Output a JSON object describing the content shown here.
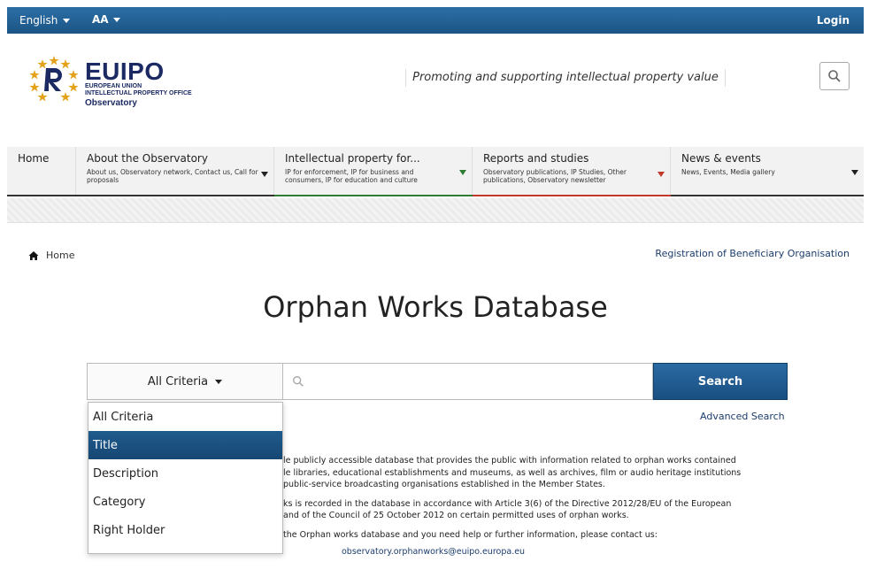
{
  "topbar": {
    "language": "English",
    "font_size": "AA",
    "login": "Login"
  },
  "header": {
    "brand": "EUIPO",
    "brand_sub1": "EUROPEAN UNION",
    "brand_sub2": "INTELLECTUAL PROPERTY OFFICE",
    "brand_obs": "Observatory",
    "tagline": "Promoting and supporting intellectual property value"
  },
  "nav": {
    "items": [
      {
        "title": "Home",
        "desc": ""
      },
      {
        "title": "About the Observatory",
        "desc": "About us, Observatory network, Contact us, Call for proposals"
      },
      {
        "title": "Intellectual property for...",
        "desc": "IP for enforcement, IP for business and consumers, IP for education and culture"
      },
      {
        "title": "Reports and studies",
        "desc": "Observatory publications, IP Studies, Other publications, Observatory newsletter"
      },
      {
        "title": "News & events",
        "desc": "News, Events, Media gallery"
      }
    ]
  },
  "breadcrumb": {
    "home": "Home"
  },
  "registration_link": "Registration of Beneficiary Organisation",
  "page_title": "Orphan Works Database",
  "search": {
    "criteria_selected": "All Criteria",
    "button": "Search",
    "advanced": "Advanced Search",
    "options": [
      "All Criteria",
      "Title",
      "Description",
      "Category",
      "Right Holder"
    ],
    "selected_index": 1
  },
  "body": {
    "p1_line1": "le publicly accessible database that provides the public with information related to orphan works contained",
    "p1_line2": "le libraries, educational establishments and museums, as well as archives, film or audio heritage institutions",
    "p1_line3": "public-service broadcasting organisations established in the Member States.",
    "p2_line1": "ks is recorded in the database in accordance with Article 3(6) of the Directive 2012/28/EU of the European",
    "p2_line2": "and of the Council of 25 October 2012 on certain permitted uses of orphan works.",
    "p3_line1": "the Orphan works database and you need help or further information, please contact us:",
    "contact": "observatory.orphanworks@euipo.europa.eu"
  },
  "colors": {
    "topbar": "#1c5485",
    "brand_navy": "#1b2a63",
    "star_gold": "#e3a21a",
    "accent_blue": "#1a4f80"
  }
}
